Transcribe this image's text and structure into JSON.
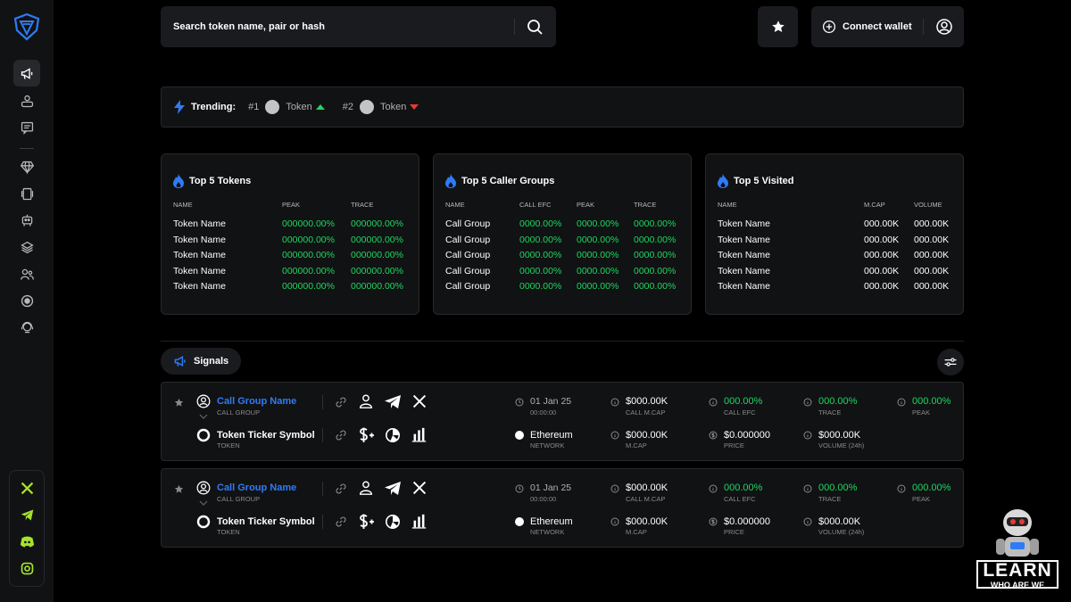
{
  "search": {
    "placeholder": "Search token name, pair or hash"
  },
  "header": {
    "connect_label": "Connect wallet"
  },
  "trending": {
    "label": "Trending:",
    "items": [
      {
        "rank": "#1",
        "name": "Token",
        "direction": "up"
      },
      {
        "rank": "#2",
        "name": "Token",
        "direction": "down"
      }
    ]
  },
  "cards": [
    {
      "title": "Top 5 Tokens",
      "headers": [
        "NAME",
        "PEAK",
        "TRACE"
      ],
      "rows": [
        [
          "Token Name",
          "000000.00%",
          "000000.00%"
        ],
        [
          "Token Name",
          "000000.00%",
          "000000.00%"
        ],
        [
          "Token Name",
          "000000.00%",
          "000000.00%"
        ],
        [
          "Token Name",
          "000000.00%",
          "000000.00%"
        ],
        [
          "Token Name",
          "000000.00%",
          "000000.00%"
        ]
      ]
    },
    {
      "title": "Top 5 Caller Groups",
      "headers": [
        "NAME",
        "CALL EFC",
        "PEAK",
        "TRACE"
      ],
      "rows": [
        [
          "Call Group",
          "0000.00%",
          "0000.00%",
          "0000.00%"
        ],
        [
          "Call Group",
          "0000.00%",
          "0000.00%",
          "0000.00%"
        ],
        [
          "Call Group",
          "0000.00%",
          "0000.00%",
          "0000.00%"
        ],
        [
          "Call Group",
          "0000.00%",
          "0000.00%",
          "0000.00%"
        ],
        [
          "Call Group",
          "0000.00%",
          "0000.00%",
          "0000.00%"
        ]
      ]
    },
    {
      "title": "Top 5 Visited",
      "headers": [
        "NAME",
        "M.CAP",
        "VOLUME"
      ],
      "rows": [
        [
          "Token Name",
          "000.00K",
          "000.00K"
        ],
        [
          "Token Name",
          "000.00K",
          "000.00K"
        ],
        [
          "Token Name",
          "000.00K",
          "000.00K"
        ],
        [
          "Token Name",
          "000.00K",
          "000.00K"
        ],
        [
          "Token Name",
          "000.00K",
          "000.00K"
        ]
      ]
    }
  ],
  "signals": {
    "label": "Signals",
    "items": [
      {
        "group_name": "Call Group Name",
        "group_sub": "CALL GROUP",
        "token_name": "Token Ticker Symbol",
        "token_sub": "TOKEN",
        "date": "01 Jan 25",
        "time": "00:00:00",
        "call_mcap": "$000.00K",
        "call_mcap_label": "CALL M.CAP",
        "call_efc": "000.00%",
        "call_efc_label": "CALL EFC",
        "trace": "000.00%",
        "trace_label": "TRACE",
        "peak": "000.00%",
        "peak_label": "PEAK",
        "network": "Ethereum",
        "network_label": "NETWORK",
        "mcap": "$000.00K",
        "mcap_label": "M.CAP",
        "price": "$0.000000",
        "price_label": "PRICE",
        "volume": "$000.00K",
        "volume_label": "VOLUME (24h)"
      },
      {
        "group_name": "Call Group Name",
        "group_sub": "CALL GROUP",
        "token_name": "Token Ticker Symbol",
        "token_sub": "TOKEN",
        "date": "01 Jan 25",
        "time": "00:00:00",
        "call_mcap": "$000.00K",
        "call_mcap_label": "CALL M.CAP",
        "call_efc": "000.00%",
        "call_efc_label": "CALL EFC",
        "trace": "000.00%",
        "trace_label": "TRACE",
        "peak": "000.00%",
        "peak_label": "PEAK",
        "network": "Ethereum",
        "network_label": "NETWORK",
        "mcap": "$000.00K",
        "mcap_label": "M.CAP",
        "price": "$0.000000",
        "price_label": "PRICE",
        "volume": "$000.00K",
        "volume_label": "VOLUME (24h)"
      }
    ]
  },
  "watermark": {
    "title": "LEARN",
    "subtitle": "WHO ARE WE"
  },
  "colors": {
    "accent_blue": "#2f7bf5",
    "positive": "#1ed760",
    "negative": "#e53935",
    "panel": "#111214"
  },
  "icons": {
    "sidebar": [
      "megaphone-icon",
      "users-icon",
      "chat-icon",
      "diamond-icon",
      "ticket-icon",
      "robot-icon",
      "layers-icon",
      "team-icon",
      "target-icon",
      "support-icon"
    ],
    "social": [
      "x-icon",
      "telegram-icon",
      "discord-icon",
      "instagram-icon"
    ]
  }
}
